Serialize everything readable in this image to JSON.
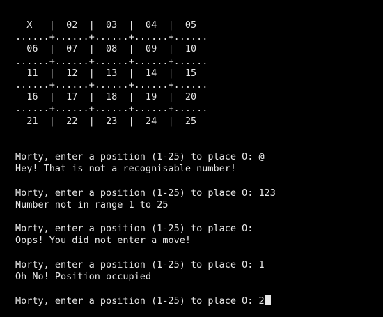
{
  "terminal": {
    "board": [
      "  X   |  02  |  03  |  04  |  05",
      "......+......+......+......+......",
      "  06  |  07  |  08  |  09  |  10",
      "......+......+......+......+......",
      "  11  |  12  |  13  |  14  |  15",
      "......+......+......+......+......",
      "  16  |  17  |  18  |  19  |  20",
      "......+......+......+......+......",
      "  21  |  22  |  23  |  24  |  25"
    ],
    "exchanges": [
      {
        "prompt": "Morty, enter a position (1-25) to place O: @",
        "response": "Hey! That is not a recognisable number!"
      },
      {
        "prompt": "Morty, enter a position (1-25) to place O: 123",
        "response": "Number not in range 1 to 25"
      },
      {
        "prompt": "Morty, enter a position (1-25) to place O:",
        "response": "Oops! You did not enter a move!"
      },
      {
        "prompt": "Morty, enter a position (1-25) to place O: 1",
        "response": "Oh No! Position occupied"
      }
    ],
    "current_prompt": "Morty, enter a position (1-25) to place O: ",
    "current_input": "2"
  }
}
